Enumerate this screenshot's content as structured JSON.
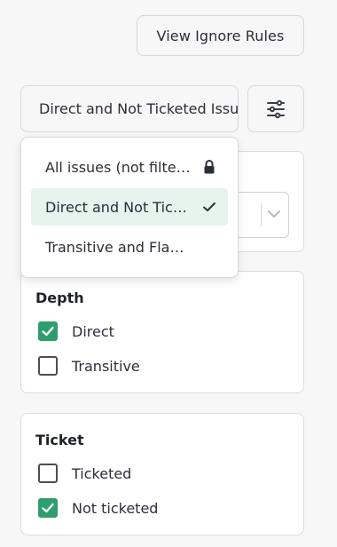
{
  "header": {
    "view_ignore_rules_label": "View Ignore Rules"
  },
  "view_select": {
    "selected_label": "Direct and Not Ticketed Issues"
  },
  "dropdown": {
    "items": [
      {
        "label": "All issues (not filtered)",
        "icon": "lock-icon",
        "selected": false
      },
      {
        "label": "Direct and Not Ticketed Issues",
        "icon": "check-icon",
        "selected": true
      },
      {
        "label": "Transitive and Flagged Issues",
        "icon": "",
        "selected": false
      }
    ]
  },
  "filters": {
    "depth": {
      "title": "Depth",
      "options": [
        {
          "label": "Direct",
          "checked": true
        },
        {
          "label": "Transitive",
          "checked": false
        }
      ]
    },
    "ticket": {
      "title": "Ticket",
      "options": [
        {
          "label": "Ticketed",
          "checked": false
        },
        {
          "label": "Not ticketed",
          "checked": true
        }
      ]
    }
  },
  "colors": {
    "accent": "#2f9e6f",
    "selected_bg": "#e7f4ee",
    "border": "#d5d8dd"
  }
}
